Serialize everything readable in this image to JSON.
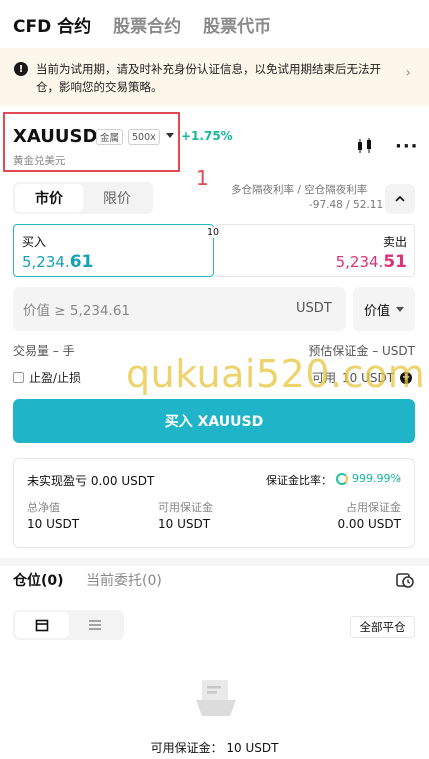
{
  "top_tabs": [
    "CFD 合约",
    "股票合约",
    "股票代币"
  ],
  "notice": {
    "text": "当前为试用期，请及时补充身份认证信息，以免试用期结束后无法开仓，影响您的交易策略。"
  },
  "symbol": {
    "name": "XAUUSD",
    "tag_type": "金属",
    "tag_leverage": "500x",
    "change": "+1.75%",
    "subtitle": "黄金兑美元",
    "annotation": "1"
  },
  "order_types": [
    "市价",
    "限价"
  ],
  "overnight": {
    "label": "多仓隔夜利率 / 空仓隔夜利率",
    "value": "-97.48 / 52.11"
  },
  "quote": {
    "buy_label": "买入",
    "buy_price_main": "5,234.",
    "buy_price_tail": "61",
    "spread": "10",
    "sell_label": "卖出",
    "sell_price_main": "5,234.",
    "sell_price_tail": "51"
  },
  "value_input": {
    "placeholder": "价值 ≥ 5,234.61",
    "unit": "USDT",
    "mode": "价值"
  },
  "volume_text": "交易量 – 手",
  "est_margin_text": "预估保证金 – USDT",
  "tpsl_label": "止盈/止损",
  "available": {
    "label": "可用",
    "value": "10 USDT"
  },
  "watermark": "qukuai520.com",
  "buy_button": "买入 XAUUSD",
  "account": {
    "pnl": "未实现盈亏 0.00 USDT",
    "ratio_label": "保证金比率：",
    "ratio_value": "999.99%",
    "equity_label": "总净值",
    "equity_value": "10 USDT",
    "avail_margin_label": "可用保证金",
    "avail_margin_value": "10 USDT",
    "used_margin_label": "占用保证金",
    "used_margin_value": "0.00 USDT"
  },
  "position_tabs": [
    "仓位(0)",
    "当前委托(0)"
  ],
  "close_all": "全部平仓",
  "footer_available": "可用保证金： 10 USDT",
  "colors": {
    "accent": "#1fb4c8",
    "buy": "#16a0b4",
    "sell": "#d8347a",
    "up": "#16b89a",
    "highlight": "#e14a52"
  }
}
